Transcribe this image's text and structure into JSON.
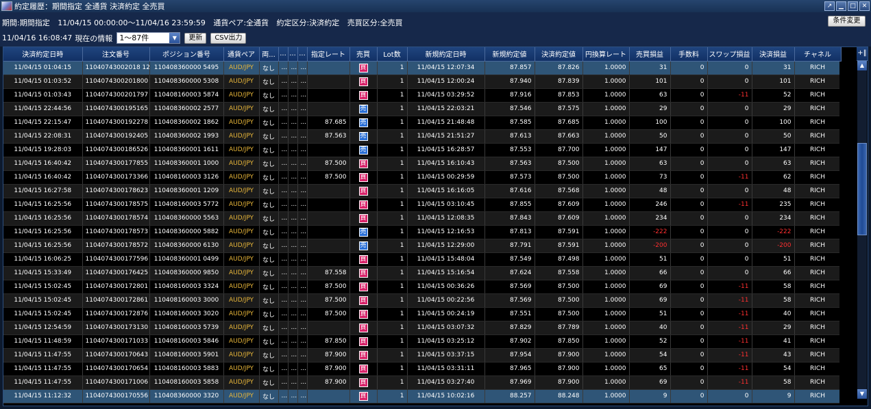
{
  "window": {
    "title": "約定履歴：期間指定 全通貨 決済約定 全売買",
    "controls": [
      "restore-icon",
      "minimize-icon",
      "maximize-icon",
      "close-icon"
    ]
  },
  "info": {
    "period_label": "期間:期間指定",
    "period_range": "11/04/15 00:00:00〜11/04/16 23:59:59",
    "pair_filter": "通貨ペア:全通貨",
    "trade_type": "約定区分:決済約定",
    "side_filter": "売買区分:全売買",
    "now_time": "11/04/16 16:08:47",
    "now_label": "現在の情報",
    "range_select_value": "1〜87件",
    "refresh_label": "更新",
    "csv_label": "CSV出力",
    "change_cond_label": "条件変更"
  },
  "colors": {
    "pair": "#e8b63a",
    "negative": "#ff3030",
    "buy_badge": "#d8246a",
    "sell_badge": "#2a6fd6",
    "selected_row": "#2f5577",
    "header": "#1f447e"
  },
  "table": {
    "columns": [
      "決済約定日時",
      "注文番号",
      "ポジション番号",
      "通貨ペア",
      "両...",
      "...",
      "...",
      "...",
      "指定レート",
      "売買",
      "Lot数",
      "新規約定日時",
      "新規約定値",
      "決済約定値",
      "円換算レート",
      "売買損益",
      "手数料",
      "スワップ損益",
      "決済損益",
      "チャネル"
    ],
    "rows": [
      [
        "11/04/15 01:04:15",
        "11040743002018 12",
        "110408360000 5495",
        "AUD/JPY",
        "なし",
        "...",
        "...",
        "...",
        "",
        "買",
        "1",
        "11/04/15 12:07:34",
        "87.857",
        "87.826",
        "1.0000",
        "31",
        "0",
        "0",
        "31",
        "RICH"
      ],
      [
        "11/04/15 01:03:52",
        "1104074300201800",
        "110408360000 5308",
        "AUD/JPY",
        "なし",
        "...",
        "...",
        "...",
        "",
        "買",
        "1",
        "11/04/15 12:00:24",
        "87.940",
        "87.839",
        "1.0000",
        "101",
        "0",
        "0",
        "101",
        "RICH"
      ],
      [
        "11/04/15 01:03:43",
        "1104074300201797",
        "110408160003 5874",
        "AUD/JPY",
        "なし",
        "...",
        "...",
        "...",
        "",
        "買",
        "1",
        "11/04/15 03:29:52",
        "87.916",
        "87.853",
        "1.0000",
        "63",
        "0",
        "-11",
        "52",
        "RICH"
      ],
      [
        "11/04/15 22:44:56",
        "1104074300195165",
        "110408360002 2577",
        "AUD/JPY",
        "なし",
        "...",
        "...",
        "...",
        "",
        "売",
        "1",
        "11/04/15 22:03:21",
        "87.546",
        "87.575",
        "1.0000",
        "29",
        "0",
        "0",
        "29",
        "RICH"
      ],
      [
        "11/04/15 22:15:47",
        "1104074300192278",
        "110408360002 1862",
        "AUD/JPY",
        "なし",
        "...",
        "...",
        "...",
        "87.685",
        "売",
        "1",
        "11/04/15 21:48:48",
        "87.585",
        "87.685",
        "1.0000",
        "100",
        "0",
        "0",
        "100",
        "RICH"
      ],
      [
        "11/04/15 22:08:31",
        "1104074300192405",
        "110408360002 1993",
        "AUD/JPY",
        "なし",
        "...",
        "...",
        "...",
        "87.563",
        "売",
        "1",
        "11/04/15 21:51:27",
        "87.613",
        "87.663",
        "1.0000",
        "50",
        "0",
        "0",
        "50",
        "RICH"
      ],
      [
        "11/04/15 19:28:03",
        "1104074300186526",
        "110408360001 1611",
        "AUD/JPY",
        "なし",
        "...",
        "...",
        "...",
        "",
        "売",
        "1",
        "11/04/15 16:28:57",
        "87.553",
        "87.700",
        "1.0000",
        "147",
        "0",
        "0",
        "147",
        "RICH"
      ],
      [
        "11/04/15 16:40:42",
        "1104074300177855",
        "110408360001 1000",
        "AUD/JPY",
        "なし",
        "...",
        "...",
        "...",
        "87.500",
        "買",
        "1",
        "11/04/15 16:10:43",
        "87.563",
        "87.500",
        "1.0000",
        "63",
        "0",
        "0",
        "63",
        "RICH"
      ],
      [
        "11/04/15 16:40:42",
        "1104074300173366",
        "110408160003 3126",
        "AUD/JPY",
        "なし",
        "...",
        "...",
        "...",
        "87.500",
        "買",
        "1",
        "11/04/15 00:29:59",
        "87.573",
        "87.500",
        "1.0000",
        "73",
        "0",
        "-11",
        "62",
        "RICH"
      ],
      [
        "11/04/15 16:27:58",
        "1104074300178623",
        "110408360001 1209",
        "AUD/JPY",
        "なし",
        "...",
        "...",
        "...",
        "",
        "買",
        "1",
        "11/04/15 16:16:05",
        "87.616",
        "87.568",
        "1.0000",
        "48",
        "0",
        "0",
        "48",
        "RICH"
      ],
      [
        "11/04/15 16:25:56",
        "1104074300178575",
        "110408160003 5772",
        "AUD/JPY",
        "なし",
        "...",
        "...",
        "...",
        "",
        "買",
        "1",
        "11/04/15 03:10:45",
        "87.855",
        "87.609",
        "1.0000",
        "246",
        "0",
        "-11",
        "235",
        "RICH"
      ],
      [
        "11/04/15 16:25:56",
        "1104074300178574",
        "110408360000 5563",
        "AUD/JPY",
        "なし",
        "...",
        "...",
        "...",
        "",
        "買",
        "1",
        "11/04/15 12:08:35",
        "87.843",
        "87.609",
        "1.0000",
        "234",
        "0",
        "0",
        "234",
        "RICH"
      ],
      [
        "11/04/15 16:25:56",
        "1104074300178573",
        "110408360000 5882",
        "AUD/JPY",
        "なし",
        "...",
        "...",
        "...",
        "",
        "売",
        "1",
        "11/04/15 12:16:53",
        "87.813",
        "87.591",
        "1.0000",
        "-222",
        "0",
        "0",
        "-222",
        "RICH"
      ],
      [
        "11/04/15 16:25:56",
        "1104074300178572",
        "110408360000 6130",
        "AUD/JPY",
        "なし",
        "...",
        "...",
        "...",
        "",
        "売",
        "1",
        "11/04/15 12:29:00",
        "87.791",
        "87.591",
        "1.0000",
        "-200",
        "0",
        "0",
        "-200",
        "RICH"
      ],
      [
        "11/04/15 16:06:25",
        "1104074300177596",
        "110408360001 0499",
        "AUD/JPY",
        "なし",
        "...",
        "...",
        "...",
        "",
        "買",
        "1",
        "11/04/15 15:48:04",
        "87.549",
        "87.498",
        "1.0000",
        "51",
        "0",
        "0",
        "51",
        "RICH"
      ],
      [
        "11/04/15 15:33:49",
        "1104074300176425",
        "110408360000 9850",
        "AUD/JPY",
        "なし",
        "...",
        "...",
        "...",
        "87.558",
        "買",
        "1",
        "11/04/15 15:16:54",
        "87.624",
        "87.558",
        "1.0000",
        "66",
        "0",
        "0",
        "66",
        "RICH"
      ],
      [
        "11/04/15 15:02:45",
        "1104074300172801",
        "110408160003 3324",
        "AUD/JPY",
        "なし",
        "...",
        "...",
        "...",
        "87.500",
        "買",
        "1",
        "11/04/15 00:36:26",
        "87.569",
        "87.500",
        "1.0000",
        "69",
        "0",
        "-11",
        "58",
        "RICH"
      ],
      [
        "11/04/15 15:02:45",
        "1104074300172861",
        "110408160003 3000",
        "AUD/JPY",
        "なし",
        "...",
        "...",
        "...",
        "87.500",
        "買",
        "1",
        "11/04/15 00:22:56",
        "87.569",
        "87.500",
        "1.0000",
        "69",
        "0",
        "-11",
        "58",
        "RICH"
      ],
      [
        "11/04/15 15:02:45",
        "1104074300172876",
        "110408160003 3020",
        "AUD/JPY",
        "なし",
        "...",
        "...",
        "...",
        "87.500",
        "買",
        "1",
        "11/04/15 00:24:19",
        "87.551",
        "87.500",
        "1.0000",
        "51",
        "0",
        "-11",
        "40",
        "RICH"
      ],
      [
        "11/04/15 12:54:59",
        "1104074300173130",
        "110408160003 5739",
        "AUD/JPY",
        "なし",
        "...",
        "...",
        "...",
        "",
        "買",
        "1",
        "11/04/15 03:07:32",
        "87.829",
        "87.789",
        "1.0000",
        "40",
        "0",
        "-11",
        "29",
        "RICH"
      ],
      [
        "11/04/15 11:48:59",
        "1104074300171033",
        "110408160003 5846",
        "AUD/JPY",
        "なし",
        "...",
        "...",
        "...",
        "87.850",
        "買",
        "1",
        "11/04/15 03:25:12",
        "87.902",
        "87.850",
        "1.0000",
        "52",
        "0",
        "-11",
        "41",
        "RICH"
      ],
      [
        "11/04/15 11:47:55",
        "1104074300170643",
        "110408160003 5901",
        "AUD/JPY",
        "なし",
        "...",
        "...",
        "...",
        "87.900",
        "買",
        "1",
        "11/04/15 03:37:15",
        "87.954",
        "87.900",
        "1.0000",
        "54",
        "0",
        "-11",
        "43",
        "RICH"
      ],
      [
        "11/04/15 11:47:55",
        "1104074300170654",
        "110408160003 5883",
        "AUD/JPY",
        "なし",
        "...",
        "...",
        "...",
        "87.900",
        "買",
        "1",
        "11/04/15 03:31:11",
        "87.965",
        "87.900",
        "1.0000",
        "65",
        "0",
        "-11",
        "54",
        "RICH"
      ],
      [
        "11/04/15 11:47:55",
        "1104074300171006",
        "110408160003 5858",
        "AUD/JPY",
        "なし",
        "...",
        "...",
        "...",
        "87.900",
        "買",
        "1",
        "11/04/15 03:27:40",
        "87.969",
        "87.900",
        "1.0000",
        "69",
        "0",
        "-11",
        "58",
        "RICH"
      ],
      [
        "11/04/15 11:12:32",
        "1104074300170556",
        "110408360000 3320",
        "AUD/JPY",
        "なし",
        "...",
        "...",
        "...",
        "",
        "買",
        "1",
        "11/04/15 10:02:16",
        "88.257",
        "88.248",
        "1.0000",
        "9",
        "0",
        "0",
        "9",
        "RICH"
      ]
    ],
    "selected_rows": [
      0,
      24
    ]
  },
  "scrollbar": {
    "corner_icon": "column-settings-icon",
    "position_fraction": 0.32
  }
}
